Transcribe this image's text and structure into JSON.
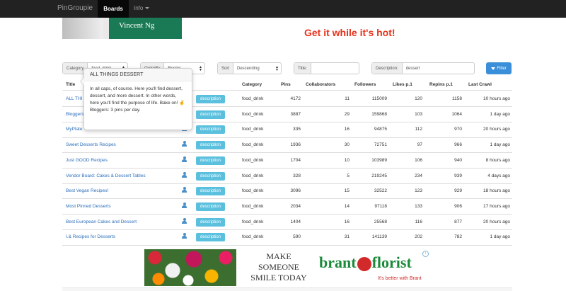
{
  "nav": {
    "brand": "PinGroupie",
    "active_tab": "Boards",
    "info_menu": "Info"
  },
  "banner": {
    "book_author": "Vincent Ng",
    "headline": "Get it while it's hot!"
  },
  "filters": {
    "category_label": "Category",
    "category_value": "food_drink",
    "orderby_label": "OrderBy",
    "orderby_value": "Repins",
    "sort_label": "Sort",
    "sort_value": "Descending",
    "title_label": "Title:",
    "title_value": "",
    "description_label": "Description:",
    "description_value": "dessert",
    "filter_button": "Filter"
  },
  "table": {
    "headers": {
      "title": "Title",
      "category": "Category",
      "pins": "Pins",
      "collaborators": "Collaborators",
      "followers": "Followers",
      "likes": "Likes p.1",
      "repins": "Repins p.1",
      "last_crawl": "Last Crawl"
    },
    "description_label": "description",
    "rows": [
      {
        "title": "ALL THI",
        "category": "food_drink",
        "pins": "4172",
        "collaborators": "11",
        "followers": "115009",
        "likes": "120",
        "repins": "1158",
        "last_crawl": "10 hours ago"
      },
      {
        "title": "Bloggers",
        "category": "food_drink",
        "pins": "3887",
        "collaborators": "29",
        "followers": "159868",
        "likes": "103",
        "repins": "1064",
        "last_crawl": "1 day ago"
      },
      {
        "title": "MyPlate",
        "category": "food_drink",
        "pins": "335",
        "collaborators": "16",
        "followers": "94875",
        "likes": "112",
        "repins": "970",
        "last_crawl": "20 hours ago"
      },
      {
        "title": "Sweet Desserts Recipes",
        "category": "food_drink",
        "pins": "1936",
        "collaborators": "30",
        "followers": "72751",
        "likes": "97",
        "repins": "966",
        "last_crawl": "1 day ago"
      },
      {
        "title": "Just GOOD Recipes",
        "category": "food_drink",
        "pins": "1704",
        "collaborators": "10",
        "followers": "103989",
        "likes": "106",
        "repins": "940",
        "last_crawl": "8 hours ago"
      },
      {
        "title": "Vendor Board: Cakes & Dessert Tables",
        "category": "food_drink",
        "pins": "328",
        "collaborators": "5",
        "followers": "219245",
        "likes": "234",
        "repins": "939",
        "last_crawl": "4 days ago"
      },
      {
        "title": "Best Vegan Recipes!",
        "category": "food_drink",
        "pins": "3096",
        "collaborators": "15",
        "followers": "32522",
        "likes": "123",
        "repins": "929",
        "last_crawl": "18 hours ago"
      },
      {
        "title": "Most Pinned Desserts",
        "category": "food_drink",
        "pins": "2034",
        "collaborators": "14",
        "followers": "97118",
        "likes": "133",
        "repins": "906",
        "last_crawl": "17 hours ago"
      },
      {
        "title": "Best European Cakes and Dessert",
        "category": "food_drink",
        "pins": "1404",
        "collaborators": "16",
        "followers": "25568",
        "likes": "116",
        "repins": "877",
        "last_crawl": "20 hours ago"
      },
      {
        "title": "I.& Recipes for Desserts",
        "category": "food_drink",
        "pins": "590",
        "collaborators": "31",
        "followers": "141139",
        "likes": "202",
        "repins": "782",
        "last_crawl": "1 day ago"
      }
    ]
  },
  "popover": {
    "title": "ALL THINGS DESSERT",
    "body": "In all caps, of course. Here you'll find dessert, dessert, and more dessert. In other words, here you'll find the purpose of life. Bake on! ✌ Bloggers: 3 pins per day."
  },
  "ad": {
    "slogan_1": "MAKE",
    "slogan_2": "SOMEONE",
    "slogan_3": "SMILE TODAY",
    "brand_1": "brant",
    "brand_2": "florist",
    "tagline": "It's better with Brant"
  },
  "colors": {
    "navbar": "#222222",
    "link": "#2a6ebb",
    "description_button": "#5bc0de",
    "filter_button": "#3a8fd8",
    "headline": "#e8311a"
  },
  "icons": {
    "collaborator": "person-icon",
    "filter": "funnel-icon"
  }
}
